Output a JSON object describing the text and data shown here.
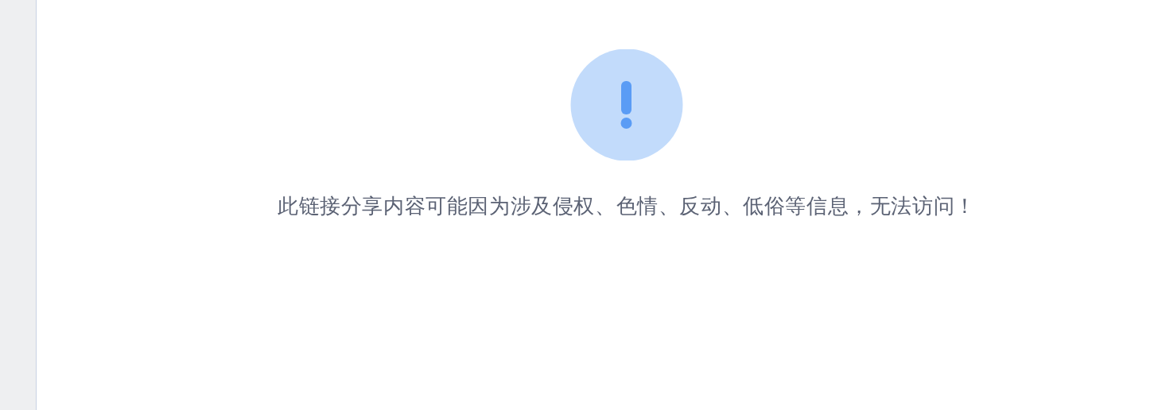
{
  "message": {
    "text": "此链接分享内容可能因为涉及侵权、色情、反动、低俗等信息，无法访问！"
  }
}
